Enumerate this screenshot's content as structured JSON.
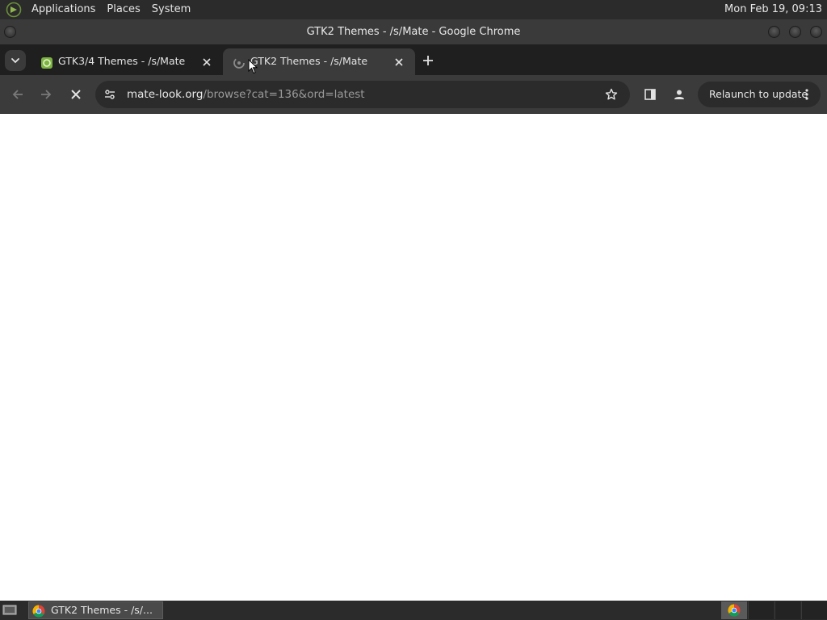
{
  "top_panel": {
    "menus": [
      "Applications",
      "Places",
      "System"
    ],
    "clock": "Mon Feb 19, 09:13"
  },
  "window": {
    "title": "GTK2 Themes - /s/Mate - Google Chrome"
  },
  "tabs": [
    {
      "title": "GTK3/4 Themes - /s/Mate",
      "active": false,
      "favicon": "mate-look-favicon"
    },
    {
      "title": "GTK2 Themes - /s/Mate",
      "active": true,
      "favicon": "loading-spinner-icon"
    }
  ],
  "toolbar": {
    "url_host": "mate-look.org",
    "url_path": "/browse?cat=136&ord=latest",
    "relaunch_label": "Relaunch to update"
  },
  "taskbar": {
    "window_button_label": "GTK2 Themes - /s/..."
  },
  "colors": {
    "panel_bg": "#2b2b2b",
    "titlebar_bg": "#3a3a3a",
    "tabstrip_bg": "#1f1f1f",
    "active_tab_bg": "#3b3b3b",
    "omnibox_bg": "#2b2b2b",
    "page_bg": "#ffffff"
  }
}
